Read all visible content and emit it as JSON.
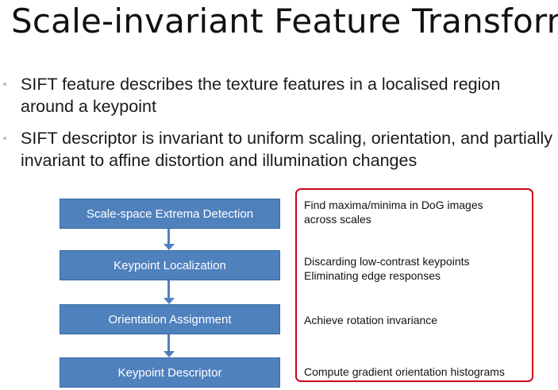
{
  "slide": {
    "title": "Scale-invariant Feature Transform",
    "bullets": [
      "SIFT feature describes the texture features in a localised region around a keypoint",
      "SIFT descriptor is invariant to uniform scaling, orientation, and partially invariant to affine distortion and illumination changes"
    ]
  },
  "pipeline": {
    "steps": [
      "Scale-space Extrema Detection",
      "Keypoint Localization",
      "Orientation Assignment",
      "Keypoint Descriptor"
    ],
    "descriptions": [
      [
        "Find maxima/minima in DoG images",
        "across scales"
      ],
      [
        "Discarding low-contrast keypoints",
        "Eliminating edge responses"
      ],
      [
        "Achieve rotation invariance"
      ],
      [
        "Compute gradient orientation histograms"
      ]
    ]
  },
  "colors": {
    "step_fill": "#4f81bd",
    "highlight_border": "#d0021b"
  }
}
